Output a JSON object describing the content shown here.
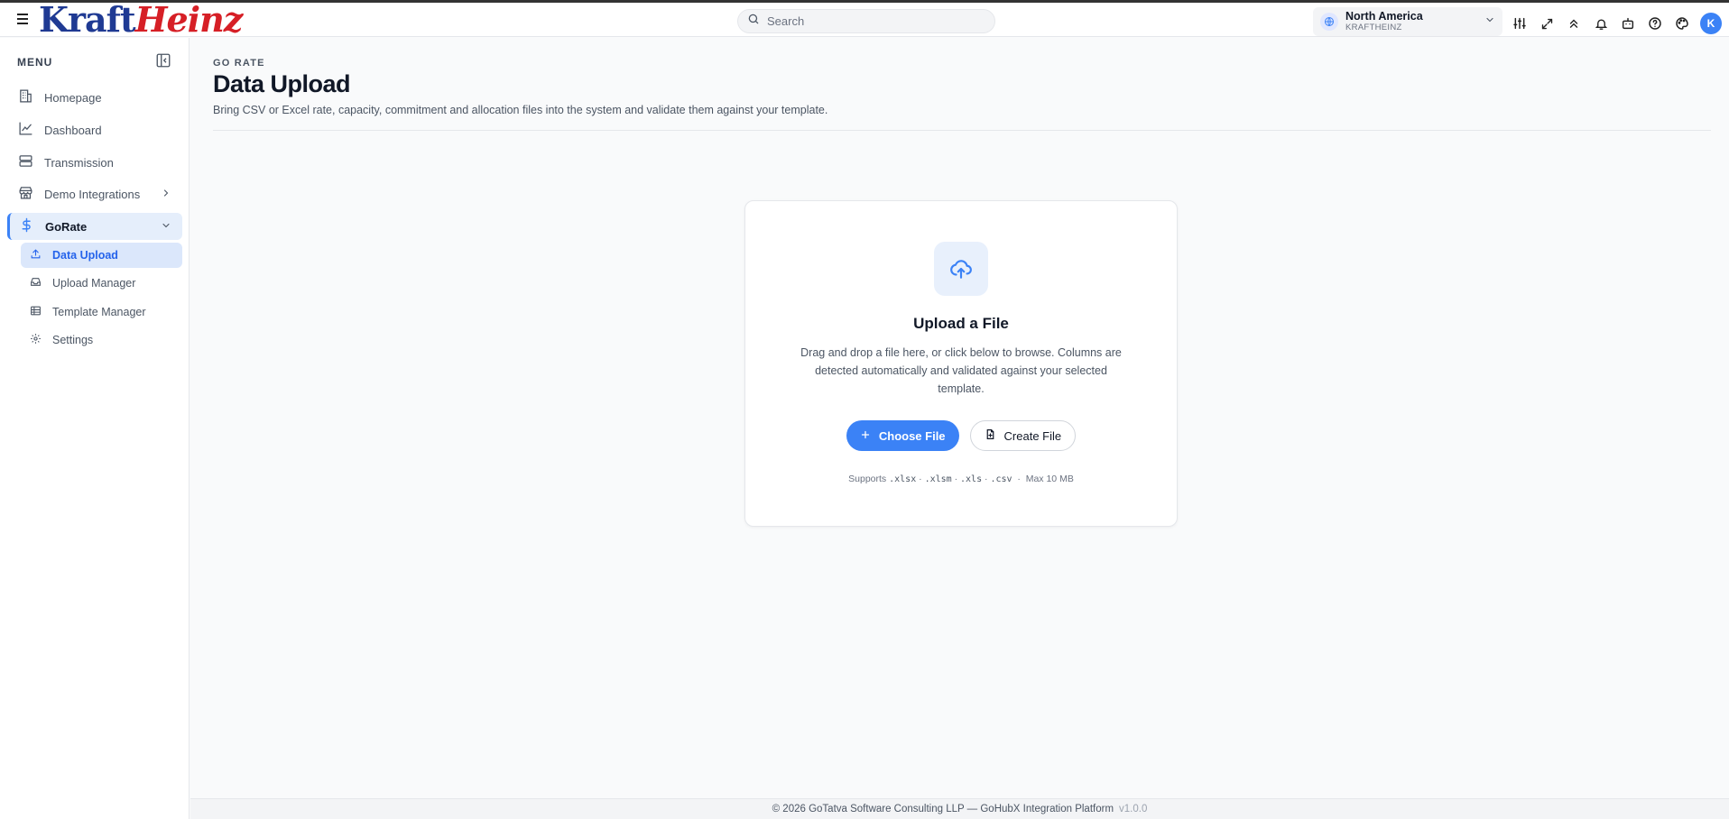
{
  "header": {
    "logo": {
      "kraft": "Kraft",
      "heinz": "Heinz"
    },
    "search_placeholder": "Search",
    "region": {
      "name": "North America",
      "org": "KRAFTHEINZ"
    },
    "icons": [
      "sliders-icon",
      "expand-icon",
      "chevrons-up-icon",
      "bell-icon",
      "bot-icon",
      "help-icon",
      "palette-icon"
    ],
    "avatar_initial": "K"
  },
  "sidebar": {
    "menu_label": "MENU",
    "items": [
      {
        "label": "Homepage",
        "icon": "building-icon"
      },
      {
        "label": "Dashboard",
        "icon": "line-chart-icon"
      },
      {
        "label": "Transmission",
        "icon": "server-icon"
      },
      {
        "label": "Demo Integrations",
        "icon": "store-icon"
      },
      {
        "label": "GoRate",
        "icon": "dollar-icon"
      }
    ],
    "subitems": [
      {
        "label": "Data Upload",
        "icon": "upload-icon"
      },
      {
        "label": "Upload Manager",
        "icon": "inbox-icon"
      },
      {
        "label": "Template Manager",
        "icon": "table-icon"
      },
      {
        "label": "Settings",
        "icon": "gear-icon"
      }
    ]
  },
  "main": {
    "eyebrow": "GO RATE",
    "title": "Data Upload",
    "subtitle": "Bring CSV or Excel rate, capacity, commitment and allocation files into the system and validate them against your template.",
    "card": {
      "title": "Upload a File",
      "description": "Drag and drop a file here, or click below to browse. Columns are detected automatically and validated against your selected template.",
      "choose_label": "Choose File",
      "create_label": "Create File",
      "supports_prefix": "Supports",
      "formats": [
        ".xlsx",
        ".xlsm",
        ".xls",
        ".csv"
      ],
      "max_size": "Max 10 MB"
    }
  },
  "footer": {
    "text": "© 2026 GoTatva Software Consulting LLP — GoHubX Integration Platform",
    "version": "v1.0.0"
  },
  "colors": {
    "accent": "#3b82f6",
    "active_bg": "#dbe7fb",
    "logo_blue": "#1f3a93",
    "logo_red": "#d61f26"
  }
}
